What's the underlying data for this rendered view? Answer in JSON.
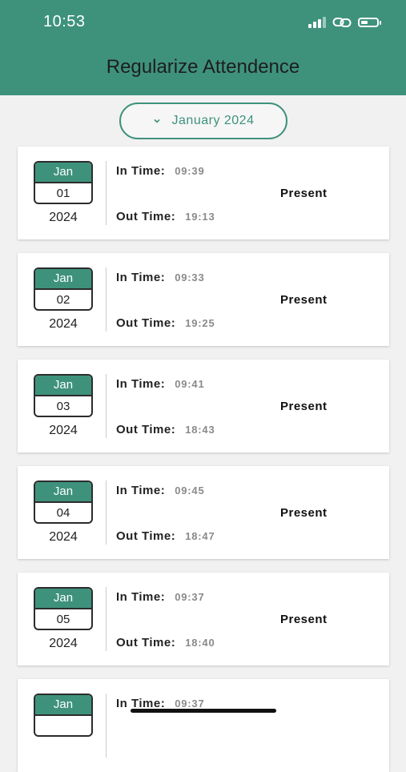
{
  "status_bar": {
    "time": "10:53"
  },
  "header": {
    "title": "Regularize Attendence"
  },
  "month_selector": {
    "label": "January 2024"
  },
  "labels": {
    "in_time": "In Time:",
    "out_time": "Out Time:"
  },
  "records": [
    {
      "month": "Jan",
      "day": "01",
      "year": "2024",
      "in_time": "09:39",
      "out_time": "19:13",
      "status": "Present"
    },
    {
      "month": "Jan",
      "day": "02",
      "year": "2024",
      "in_time": "09:33",
      "out_time": "19:25",
      "status": "Present"
    },
    {
      "month": "Jan",
      "day": "03",
      "year": "2024",
      "in_time": "09:41",
      "out_time": "18:43",
      "status": "Present"
    },
    {
      "month": "Jan",
      "day": "04",
      "year": "2024",
      "in_time": "09:45",
      "out_time": "18:47",
      "status": "Present"
    },
    {
      "month": "Jan",
      "day": "05",
      "year": "2024",
      "in_time": "09:37",
      "out_time": "18:40",
      "status": "Present"
    },
    {
      "month": "Jan",
      "day": "",
      "year": "",
      "in_time": "09:37",
      "out_time": "",
      "status": ""
    }
  ],
  "colors": {
    "primary": "#3e927c",
    "background": "#f1f1f1"
  },
  "icons": {
    "signal": "signal-icon",
    "link": "link-icon",
    "battery": "battery-icon",
    "chevron": "chevron-down-icon"
  }
}
